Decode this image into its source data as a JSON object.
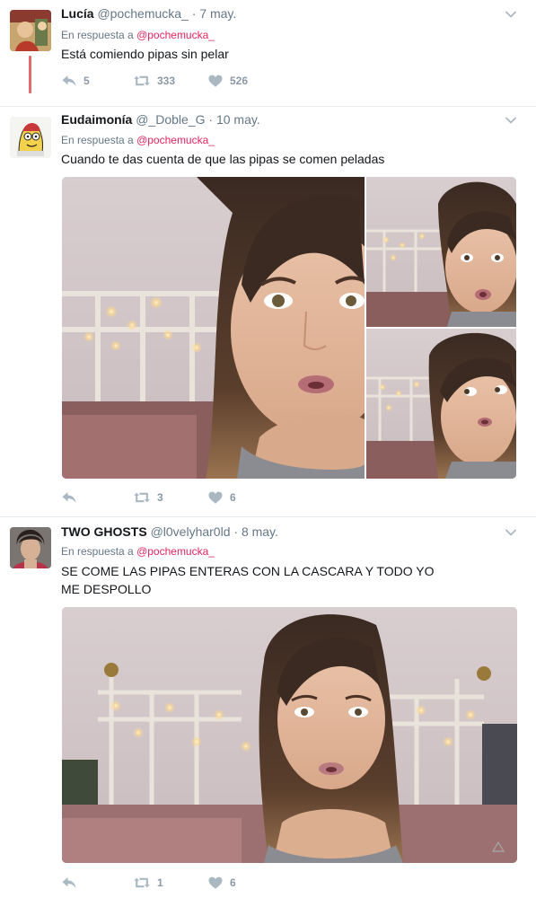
{
  "tweets": [
    {
      "name": "Lucía",
      "handle": "@pochemucka_",
      "dot": "·",
      "date": "7 may.",
      "reply_prefix": "En respuesta a",
      "reply_mention": "@pochemucka_",
      "text": "Está comiendo pipas sin pelar",
      "replies": "5",
      "retweets": "333",
      "likes": "526"
    },
    {
      "name": "Eudaimonía",
      "handle": "@_Doble_G",
      "dot": "·",
      "date": "10 may.",
      "reply_prefix": "En respuesta a",
      "reply_mention": "@pochemucka_",
      "text": "Cuando te das cuenta de que las pipas se comen peladas",
      "replies": "",
      "retweets": "3",
      "likes": "6"
    },
    {
      "name": "TWO GHOSTS",
      "handle": "@l0velyhar0ld",
      "dot": "·",
      "date": "8 may.",
      "reply_prefix": "En respuesta a",
      "reply_mention": "@pochemucka_",
      "text": "SE COME LAS PIPAS ENTERAS CON LA CASCARA Y TODO YO ME DESPOLLO",
      "replies": "",
      "retweets": "1",
      "likes": "6"
    }
  ],
  "icons": {
    "reply": "reply-icon",
    "retweet": "retweet-icon",
    "like": "heart-icon",
    "caret": "chevron-down-icon"
  },
  "colors": {
    "mention": "#e0245e",
    "thread_line": "#e26b70",
    "muted": "#657786",
    "action_icon": "#aab8c2"
  }
}
